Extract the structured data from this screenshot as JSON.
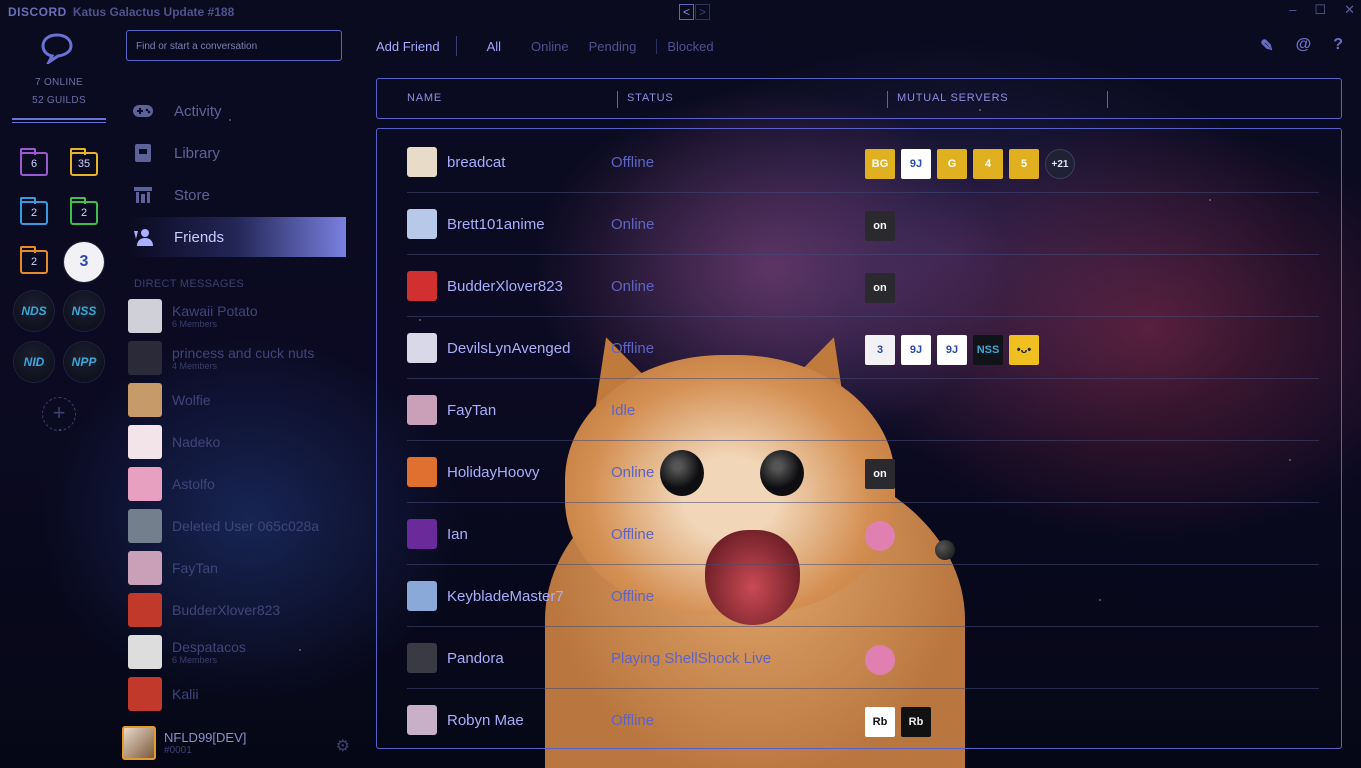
{
  "window": {
    "logo": "DISCORD",
    "title": "Katus Galactus Update #188",
    "back": "<",
    "forward": ">",
    "controls": [
      "–",
      "☐",
      "✕"
    ]
  },
  "rail": {
    "online": "7 ONLINE",
    "guilds": "52 GUILDS",
    "folders": [
      {
        "count": "6",
        "color": "#9b59d0"
      },
      {
        "count": "35",
        "color": "#e8b32c"
      },
      {
        "count": "2",
        "color": "#3a9ae0"
      },
      {
        "count": "2",
        "color": "#3fbf4a"
      },
      {
        "count": "2",
        "color": "#e88a2c"
      }
    ],
    "servers": [
      "NDS",
      "NSS",
      "NID",
      "NPP"
    ],
    "add": "+"
  },
  "channels": {
    "search_placeholder": "Find or start a conversation",
    "nav": [
      {
        "label": "Activity",
        "icon": "gamepad-icon"
      },
      {
        "label": "Library",
        "icon": "library-icon"
      },
      {
        "label": "Store",
        "icon": "store-icon"
      },
      {
        "label": "Friends",
        "icon": "friends-icon"
      }
    ],
    "dm_header": "DIRECT MESSAGES",
    "dms": [
      {
        "name": "Kawaii Potato",
        "sub": "6 Members",
        "color": "#d0d0d8"
      },
      {
        "name": "princess and cuck nuts",
        "sub": "4 Members",
        "color": "#2a2a38"
      },
      {
        "name": "Wolfie",
        "sub": "",
        "color": "#c79a6a"
      },
      {
        "name": "Nadeko",
        "sub": "",
        "color": "#f3e4ea"
      },
      {
        "name": "Astolfo",
        "sub": "",
        "color": "#e8a0c0"
      },
      {
        "name": "Deleted User 065c028a",
        "sub": "",
        "color": "#747f8d"
      },
      {
        "name": "FayTan",
        "sub": "",
        "color": "#c9a0b8"
      },
      {
        "name": "BudderXlover823",
        "sub": "",
        "color": "#c0392b"
      },
      {
        "name": "Despatacos",
        "sub": "6 Members",
        "color": "#ddd"
      },
      {
        "name": "Kalii",
        "sub": "",
        "color": "#c0392b"
      }
    ],
    "user": {
      "name": "NFLD99[DEV]",
      "tag": "#0001",
      "settings": "⚙"
    }
  },
  "topbar": {
    "add_friend": "Add Friend",
    "tabs": [
      "All",
      "Online",
      "Pending",
      "Blocked"
    ],
    "icons": [
      "✎",
      "@",
      "?"
    ]
  },
  "table": {
    "headers": [
      "NAME",
      "STATUS",
      "MUTUAL SERVERS"
    ],
    "rows": [
      {
        "name": "breadcat",
        "status": "Offline",
        "avatar": "#e8dcc8",
        "servers": [
          {
            "label": "BG",
            "bg": "#e0b020"
          },
          {
            "label": "9J",
            "bg": "#ffffff",
            "fg": "#2a4ab0"
          },
          {
            "label": "G",
            "bg": "#e0b020"
          },
          {
            "label": "4",
            "bg": "#e0b020"
          },
          {
            "label": "5",
            "bg": "#e0b020"
          }
        ],
        "more": "+21"
      },
      {
        "name": "Brett101anime",
        "status": "Online",
        "avatar": "#b8c8e8",
        "servers": [
          {
            "label": "on",
            "bg": "#2a2a2e"
          }
        ],
        "more": ""
      },
      {
        "name": "BudderXlover823",
        "status": "Online",
        "avatar": "#d03030",
        "servers": [
          {
            "label": "on",
            "bg": "#2a2a2e"
          }
        ],
        "more": ""
      },
      {
        "name": "DevilsLynAvenged",
        "status": "Offline",
        "avatar": "#d8d8e8",
        "servers": [
          {
            "label": "3",
            "bg": "#f2f2f6",
            "fg": "#2f4aa8"
          },
          {
            "label": "9J",
            "bg": "#ffffff",
            "fg": "#2a4ab0"
          },
          {
            "label": "9J",
            "bg": "#ffffff",
            "fg": "#2a4ab0"
          },
          {
            "label": "NSS",
            "bg": "#101418",
            "fg": "#3aa8d8"
          },
          {
            "label": "•ᴗ•",
            "bg": "#f0c020",
            "fg": "#222"
          }
        ],
        "more": ""
      },
      {
        "name": "FayTan",
        "status": "Idle",
        "avatar": "#c9a0b8",
        "servers": [],
        "more": ""
      },
      {
        "name": "HolidayHoovy",
        "status": "Online",
        "avatar": "#e07030",
        "servers": [
          {
            "label": "on",
            "bg": "#2a2a2e"
          }
        ],
        "more": ""
      },
      {
        "name": "Ian",
        "status": "Offline",
        "avatar": "#6a2a9a",
        "servers": [
          {
            "label": "",
            "bg": "#e080b0",
            "round": true
          }
        ],
        "more": ""
      },
      {
        "name": "KeybladeMaster7",
        "status": "Offline",
        "avatar": "#8aa8d8",
        "servers": [],
        "more": ""
      },
      {
        "name": "Pandora",
        "status": "Playing ShellShock Live",
        "avatar": "#3a3a44",
        "servers": [
          {
            "label": "",
            "bg": "#e080b0",
            "round": true
          }
        ],
        "more": ""
      },
      {
        "name": "Robyn Mae",
        "status": "Offline",
        "avatar": "#c8b0c8",
        "servers": [
          {
            "label": "Rb",
            "bg": "#ffffff",
            "fg": "#111"
          },
          {
            "label": "Rb",
            "bg": "#111111",
            "fg": "#eee"
          }
        ],
        "more": ""
      }
    ]
  }
}
